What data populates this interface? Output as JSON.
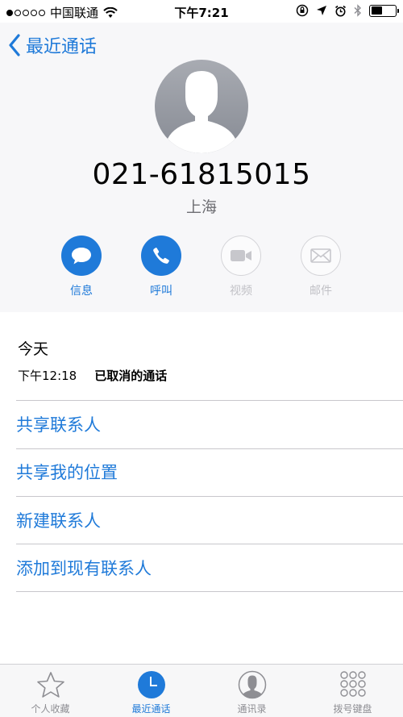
{
  "status_bar": {
    "carrier": "中国联通",
    "time": "下午7:21",
    "battery_level": 0.45
  },
  "header": {
    "back_label": "最近通话",
    "phone_number": "021-61815015",
    "region": "上海"
  },
  "actions": [
    {
      "label": "信息",
      "icon": "message-icon",
      "enabled": true
    },
    {
      "label": "呼叫",
      "icon": "phone-icon",
      "enabled": true
    },
    {
      "label": "视频",
      "icon": "video-camera-icon",
      "enabled": false
    },
    {
      "label": "邮件",
      "icon": "mail-icon",
      "enabled": false
    }
  ],
  "call_history": {
    "day_label": "今天",
    "entries": [
      {
        "time": "下午12:18",
        "status": "已取消的通话"
      }
    ]
  },
  "links": [
    "共享联系人",
    "共享我的位置",
    "新建联系人",
    "添加到现有联系人"
  ],
  "tab_bar": {
    "tabs": [
      {
        "label": "个人收藏",
        "icon": "star-icon",
        "selected": false
      },
      {
        "label": "最近通话",
        "icon": "clock-icon",
        "selected": true
      },
      {
        "label": "通讯录",
        "icon": "contacts-icon",
        "selected": false
      },
      {
        "label": "拨号键盘",
        "icon": "keypad-icon",
        "selected": false
      }
    ]
  },
  "colors": {
    "accent": "#1f7ad9",
    "disabled": "#c1c1c6",
    "header_bg": "#f7f7f9"
  }
}
